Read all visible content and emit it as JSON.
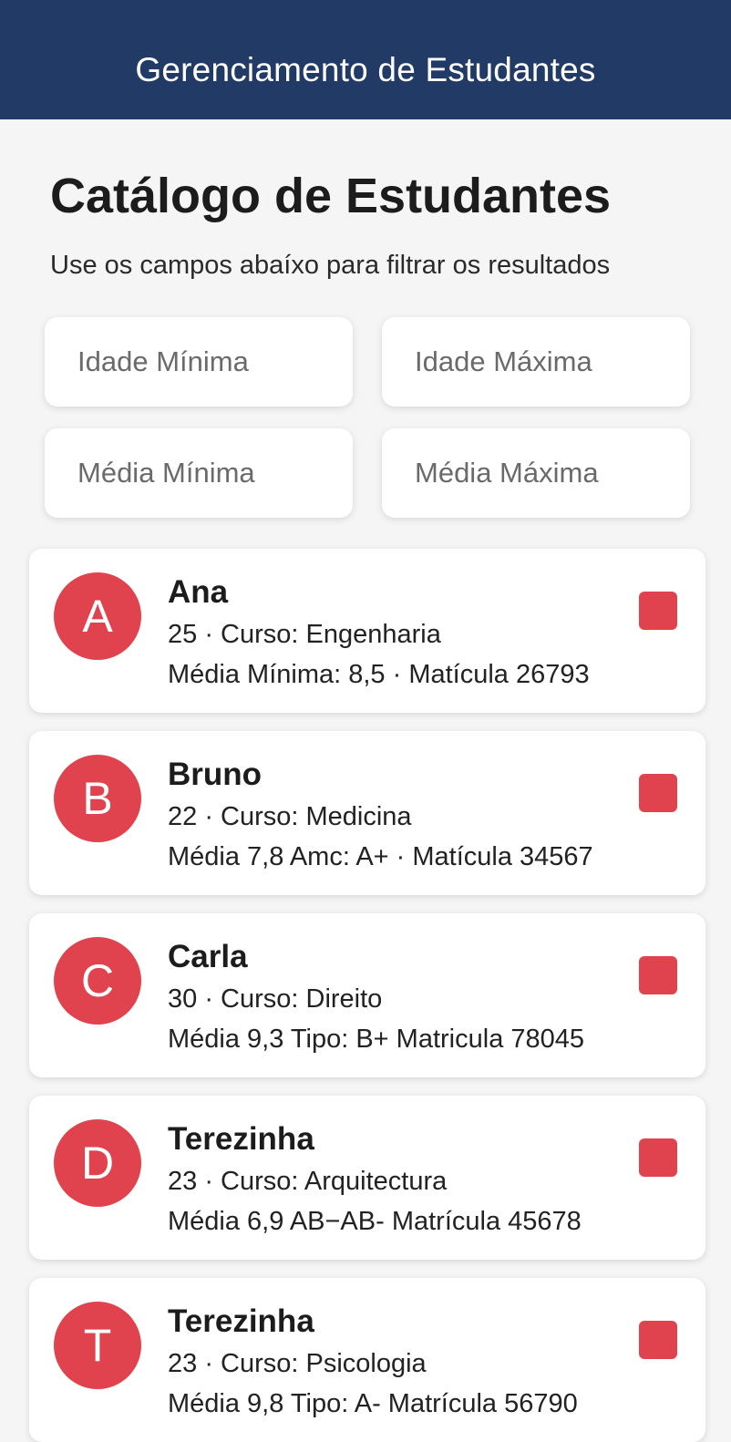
{
  "header": {
    "title": "Gerenciamento de Estudantes"
  },
  "page": {
    "title": "Catálogo de Estudantes",
    "subtitle": "Use os campos abaíxo para filtrar os resultados"
  },
  "filters": {
    "idade_min": {
      "placeholder": "Idade Mínima",
      "value": ""
    },
    "idade_max": {
      "placeholder": "Idade Máxima",
      "value": ""
    },
    "media_min": {
      "placeholder": "Média Mínima",
      "value": ""
    },
    "media_max": {
      "placeholder": "Média Máxima",
      "value": ""
    }
  },
  "students": [
    {
      "initial": "A",
      "name": "Ana",
      "line1": "25 · Curso: Engenharia",
      "line2": "Média Mínima: 8,5 · Matícula 26793"
    },
    {
      "initial": "B",
      "name": "Bruno",
      "line1": "22 · Curso: Medicina",
      "line2": "Média 7,8 Amc: A+ · Matícula 34567"
    },
    {
      "initial": "C",
      "name": "Carla",
      "line1": "30 · Curso: Direito",
      "line2": "Média 9,3  Tipo: B+  Matricula 78045"
    },
    {
      "initial": "D",
      "name": "Terezinha",
      "line1": "23 · Curso: Arquitectura",
      "line2": "Média 6,9 AB−AB-  Matrícula 45678"
    },
    {
      "initial": "T",
      "name": "Terezinha",
      "line1": "23 · Curso: Psicologia",
      "line2": "Média 9,8  Tipo: A-  Matrícula 56790"
    }
  ],
  "colors": {
    "header_bg": "#223b66",
    "accent": "#e0434d",
    "page_bg": "#f5f5f5"
  },
  "icons": {
    "remove": "remove-square-icon"
  }
}
